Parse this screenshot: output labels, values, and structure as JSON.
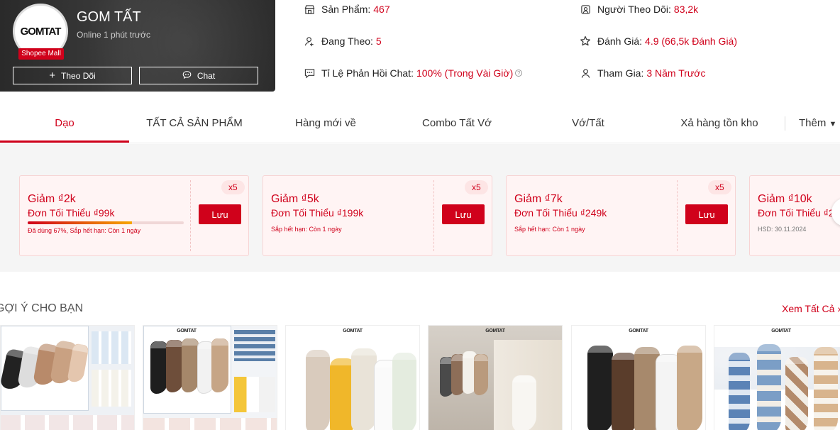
{
  "shop": {
    "logo_text": "GOMTAT",
    "mall_badge": "Shopee Mall",
    "name": "GOM TẤT",
    "status": "Online 1 phút trước",
    "follow_label": "Theo Dõi",
    "chat_label": "Chat"
  },
  "stats": {
    "products": {
      "label": "Sản Phẩm:",
      "value": "467",
      "icon": "store-icon"
    },
    "following": {
      "label": "Đang Theo:",
      "value": "5",
      "icon": "user-add-icon"
    },
    "chat_rate": {
      "label": "Tỉ Lệ Phản Hồi Chat:",
      "value": "100% (Trong Vài Giờ)",
      "icon": "chat-icon"
    },
    "followers": {
      "label": "Người Theo Dõi:",
      "value": "83,2k",
      "icon": "followers-icon"
    },
    "rating": {
      "label": "Đánh Giá:",
      "value": "4.9 (66,5k Đánh Giá)",
      "icon": "star-icon"
    },
    "joined": {
      "label": "Tham Gia:",
      "value": "3 Năm Trước",
      "icon": "user-icon"
    }
  },
  "tabs": [
    "Dạo",
    "TẤT CẢ SẢN PHẨM",
    "Hàng mới về",
    "Combo Tất Vớ",
    "Vớ/Tất",
    "Xả hàng tồn kho",
    "Thêm"
  ],
  "vouchers": [
    {
      "title": "Giảm ₫2k",
      "min": "Đơn Tối Thiểu ₫99k",
      "progress": 0.67,
      "note": "Đã dùng 67%, Sắp hết hạn: Còn 1 ngày",
      "qty": "x5",
      "save": "Lưu"
    },
    {
      "title": "Giảm ₫5k",
      "min": "Đơn Tối Thiểu ₫199k",
      "note": "Sắp hết hạn: Còn 1 ngày",
      "qty": "x5",
      "save": "Lưu"
    },
    {
      "title": "Giảm ₫7k",
      "min": "Đơn Tối Thiểu ₫249k",
      "note": "Sắp hết hạn: Còn 1 ngày",
      "qty": "x5",
      "save": "Lưu"
    },
    {
      "title": "Giảm ₫10k",
      "min": "Đơn Tối Thiểu ₫2",
      "note": "HSD: 30.11.2024"
    }
  ],
  "recommend": {
    "title": "GỢI Ý CHO BẠN",
    "see_all": "Xem Tất Cả"
  },
  "colors": {
    "accent": "#d0011b",
    "voucher_bg": "#fff4f4"
  }
}
